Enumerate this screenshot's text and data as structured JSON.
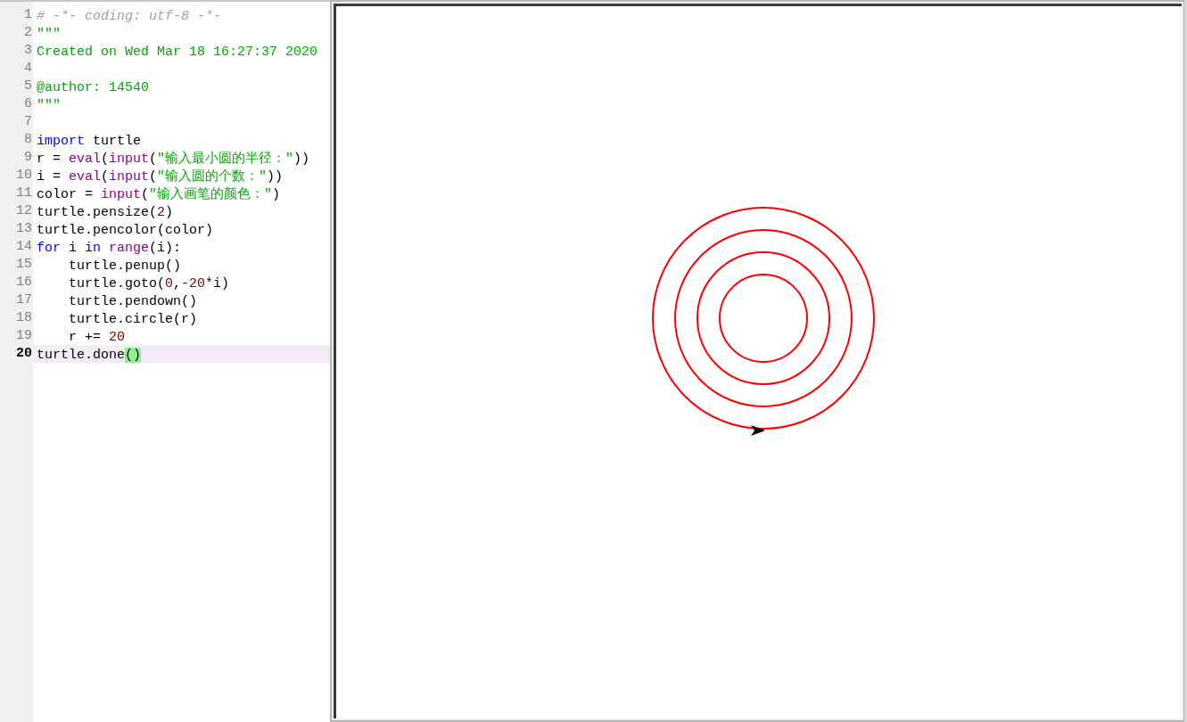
{
  "editor": {
    "lines": [
      {
        "number": "1",
        "current": false,
        "tokens": [
          {
            "kind": "comment",
            "text": "# -*- coding: utf-8 -*-"
          }
        ]
      },
      {
        "number": "2",
        "current": false,
        "tokens": [
          {
            "kind": "string",
            "text": "\"\"\""
          }
        ]
      },
      {
        "number": "3",
        "current": false,
        "tokens": [
          {
            "kind": "string",
            "text": "Created on Wed Mar 18 16:27:37 2020"
          }
        ]
      },
      {
        "number": "4",
        "current": false
      },
      {
        "number": "5",
        "current": false,
        "tokens": [
          {
            "kind": "string",
            "text": "@author: 14540"
          }
        ]
      },
      {
        "number": "6",
        "current": false,
        "tokens": [
          {
            "kind": "string",
            "text": "\"\"\""
          }
        ]
      },
      {
        "number": "7",
        "current": false
      },
      {
        "number": "8",
        "current": false,
        "tokens": [
          {
            "kind": "keyword",
            "text": "import"
          },
          {
            "kind": "plain",
            "text": " turtle"
          }
        ]
      },
      {
        "number": "9",
        "current": false,
        "tokens": [
          {
            "kind": "plain",
            "text": "r = "
          },
          {
            "kind": "builtin",
            "text": "eval"
          },
          {
            "kind": "plain",
            "text": "("
          },
          {
            "kind": "builtin",
            "text": "input"
          },
          {
            "kind": "plain",
            "text": "("
          },
          {
            "kind": "string",
            "text": "\"输入最小圆的半径：\""
          },
          {
            "kind": "plain",
            "text": "))"
          }
        ]
      },
      {
        "number": "10",
        "current": false,
        "tokens": [
          {
            "kind": "plain",
            "text": "i = "
          },
          {
            "kind": "builtin",
            "text": "eval"
          },
          {
            "kind": "plain",
            "text": "("
          },
          {
            "kind": "builtin",
            "text": "input"
          },
          {
            "kind": "plain",
            "text": "("
          },
          {
            "kind": "string",
            "text": "\"输入圆的个数：\""
          },
          {
            "kind": "plain",
            "text": "))"
          }
        ]
      },
      {
        "number": "11",
        "current": false,
        "tokens": [
          {
            "kind": "plain",
            "text": "color = "
          },
          {
            "kind": "builtin",
            "text": "input"
          },
          {
            "kind": "plain",
            "text": "("
          },
          {
            "kind": "string",
            "text": "\"输入画笔的颜色：\""
          },
          {
            "kind": "plain",
            "text": ")"
          }
        ]
      },
      {
        "number": "12",
        "current": false,
        "tokens": [
          {
            "kind": "plain",
            "text": "turtle.pensize("
          },
          {
            "kind": "number",
            "text": "2"
          },
          {
            "kind": "plain",
            "text": ")"
          }
        ]
      },
      {
        "number": "13",
        "current": false,
        "tokens": [
          {
            "kind": "plain",
            "text": "turtle.pencolor(color)"
          }
        ]
      },
      {
        "number": "14",
        "current": false,
        "tokens": [
          {
            "kind": "keyword",
            "text": "for"
          },
          {
            "kind": "plain",
            "text": " i "
          },
          {
            "kind": "keyword",
            "text": "in"
          },
          {
            "kind": "builtin",
            "text": " range"
          },
          {
            "kind": "plain",
            "text": "(i):"
          }
        ]
      },
      {
        "number": "15",
        "current": false,
        "tokens": [
          {
            "kind": "plain",
            "text": "    turtle.penup()"
          }
        ]
      },
      {
        "number": "16",
        "current": false,
        "tokens": [
          {
            "kind": "plain",
            "text": "    turtle.goto("
          },
          {
            "kind": "number",
            "text": "0"
          },
          {
            "kind": "plain",
            "text": ","
          },
          {
            "kind": "number",
            "text": "-20"
          },
          {
            "kind": "plain",
            "text": "*i)"
          }
        ]
      },
      {
        "number": "17",
        "current": false,
        "tokens": [
          {
            "kind": "plain",
            "text": "    turtle.pendown()"
          }
        ]
      },
      {
        "number": "18",
        "current": false,
        "tokens": [
          {
            "kind": "plain",
            "text": "    turtle.circle(r)"
          }
        ]
      },
      {
        "number": "19",
        "current": false,
        "tokens": [
          {
            "kind": "plain",
            "text": "    r += "
          },
          {
            "kind": "number",
            "text": "20"
          }
        ]
      },
      {
        "number": "20",
        "current": true,
        "tokens": [
          {
            "kind": "plain",
            "text": "turtle.done"
          },
          {
            "kind": "brace_match",
            "text": "()"
          }
        ]
      }
    ]
  }
}
